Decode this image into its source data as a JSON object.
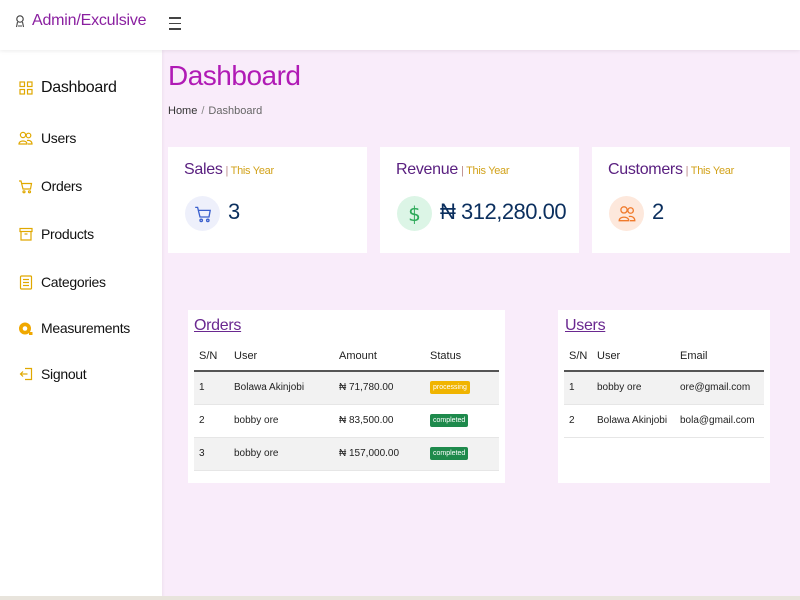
{
  "brand": {
    "title": "Admin/Exculsive"
  },
  "sidebar": {
    "items": [
      {
        "label": "Dashboard",
        "icon": "grid-icon"
      },
      {
        "label": "Users",
        "icon": "users-icon"
      },
      {
        "label": "Orders",
        "icon": "cart-icon"
      },
      {
        "label": "Products",
        "icon": "archive-icon"
      },
      {
        "label": "Categories",
        "icon": "list-icon"
      },
      {
        "label": "Measurements",
        "icon": "tape-icon"
      },
      {
        "label": "Signout",
        "icon": "signout-icon"
      }
    ]
  },
  "main": {
    "title": "Dashboard",
    "breadcrumb": {
      "home": "Home",
      "separator": "/",
      "current": "Dashboard"
    }
  },
  "cards": [
    {
      "title": "Sales",
      "sub": "This Year",
      "value": "3",
      "icon": "cart-icon",
      "circle_color": "#eef0fb",
      "icon_color": "#3a5fcd"
    },
    {
      "title": "Revenue",
      "sub": "This Year",
      "value": "₦ 312,280.00",
      "icon": "dollar-icon",
      "circle_color": "#dcf5e6",
      "icon_color": "#2eaa5a"
    },
    {
      "title": "Customers",
      "sub": "This Year",
      "value": "2",
      "icon": "people-icon",
      "circle_color": "#fde8dc",
      "icon_color": "#f07a2b"
    }
  ],
  "orders": {
    "title": "Orders",
    "columns": [
      "S/N",
      "User",
      "Amount",
      "Status"
    ],
    "rows": [
      {
        "sn": "1",
        "user": "Bolawa Akinjobi",
        "amount": "₦ 71,780.00",
        "status": "processing"
      },
      {
        "sn": "2",
        "user": "bobby ore",
        "amount": "₦ 83,500.00",
        "status": "completed"
      },
      {
        "sn": "3",
        "user": "bobby ore",
        "amount": "₦ 157,000.00",
        "status": "completed"
      }
    ]
  },
  "users": {
    "title": "Users",
    "columns": [
      "S/N",
      "User",
      "Email"
    ],
    "rows": [
      {
        "sn": "1",
        "user": "bobby ore",
        "email": "ore@gmail.com"
      },
      {
        "sn": "2",
        "user": "Bolawa Akinjobi",
        "email": "bola@gmail.com"
      }
    ]
  },
  "colors": {
    "accent": "#b01ab5",
    "background": "#f9ecfa",
    "status_processing": "#f0b400",
    "status_completed": "#1e8a4c"
  }
}
